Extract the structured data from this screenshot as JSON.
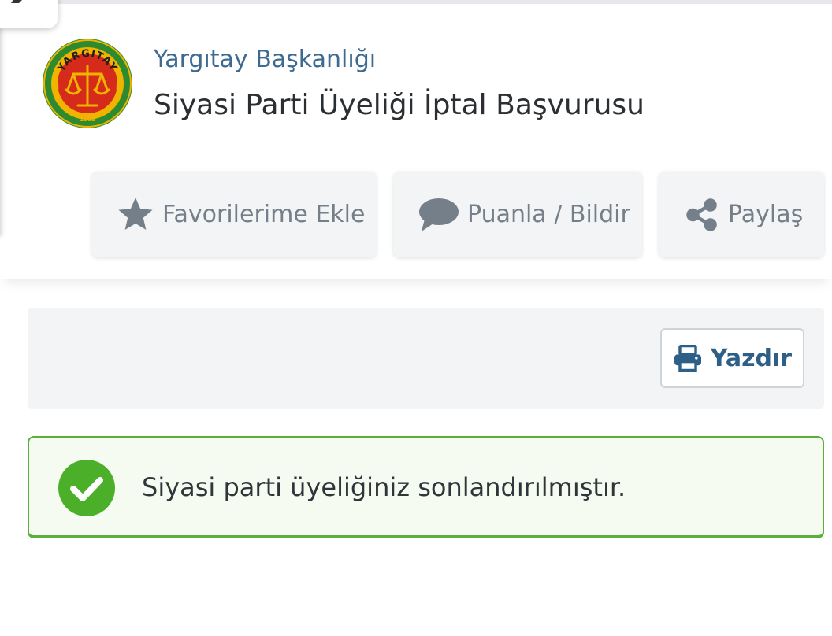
{
  "header": {
    "agency": "Yargıtay Başkanlığı",
    "title": "Siyasi Parti Üyeliği İptal Başvurusu",
    "logo_text": "YARGITAY",
    "logo_year": "1868"
  },
  "actions": {
    "favorite_label": "Favorilerime Ekle",
    "rate_label": "Puanla / Bildir",
    "share_label": "Paylaş"
  },
  "toolbar": {
    "print_label": "Yazdır"
  },
  "alert": {
    "status": "success",
    "message": "Siyasi parti üyeliğiniz sonlandırılmıştır."
  },
  "icons": {
    "favorite": "star-icon",
    "rate": "comment-icon",
    "share": "share-icon",
    "print": "printer-icon",
    "success": "check-circle-icon",
    "corner": "pencil-icon"
  },
  "colors": {
    "agency_text": "#3d6a90",
    "title_text": "#2b2f33",
    "action_text": "#757f89",
    "action_bg": "#f3f4f6",
    "print_text": "#2e5f86",
    "success_green": "#4caf2a",
    "success_border": "#5bb03c",
    "success_bg": "#f6fbf2",
    "logo_green": "#2d8a2f",
    "logo_red": "#d62a1a",
    "logo_gold": "#f0b400"
  }
}
